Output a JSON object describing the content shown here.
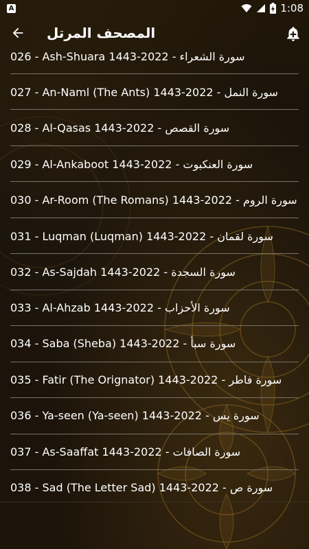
{
  "status_bar": {
    "time": "1:08",
    "notification_icon": "A",
    "icons": [
      "wifi-icon",
      "signal-icon",
      "battery-charging-icon"
    ]
  },
  "app_bar": {
    "title": "المصحف المرتل",
    "back_icon": "arrow-left-icon",
    "action_icon": "alarm-add-icon"
  },
  "colors": {
    "background": "#1a130a",
    "ornament": "#8a6420",
    "divider": "#7a7468",
    "text": "#ffffff"
  },
  "surahs": [
    {
      "label": "026 - Ash-Shuara  1443-2022 - سورة الشعراء"
    },
    {
      "label": "027 - An-Naml (The Ants) 1443-2022 - سورة النمل"
    },
    {
      "label": "028 - Al-Qasas 1443-2022 - سورة القصص"
    },
    {
      "label": "029 - Al-Ankaboot  1443-2022 - سورة العنكبوت"
    },
    {
      "label": "030 - Ar-Room (The Romans) 1443-2022 - سورة الروم"
    },
    {
      "label": "031 - Luqman (Luqman) 1443-2022 - سورة لقمان"
    },
    {
      "label": "032 - As-Sajdah  1443-2022 - سورة السجدة"
    },
    {
      "label": "033 - Al-Ahzab  1443-2022 - سورة الأحزاب"
    },
    {
      "label": "034 - Saba (Sheba) 1443-2022 - سورة سبأ"
    },
    {
      "label": "035 - Fatir (The Orignator) 1443-2022 - سورة فاطر"
    },
    {
      "label": "036 - Ya-seen (Ya-seen) 1443-2022 - سورة يس"
    },
    {
      "label": "037 - As-Saaffat 1443-2022 - سورة الصافات"
    },
    {
      "label": "038 - Sad (The Letter Sad) 1443-2022 - سورة ص"
    }
  ]
}
